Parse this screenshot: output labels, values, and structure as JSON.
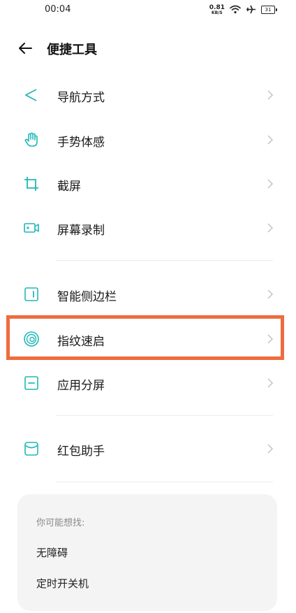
{
  "status_bar": {
    "time": "00:04",
    "net_speed_value": "0.81",
    "net_speed_unit": "KB/S",
    "battery": "31",
    "icons": [
      "wifi-icon",
      "airplane-icon",
      "battery-icon"
    ]
  },
  "header": {
    "title": "便捷工具"
  },
  "accent_color": "#20b7b7",
  "highlight_color": "#ef6c3e",
  "groups": [
    {
      "items": [
        {
          "label": "导航方式",
          "icon": "navigation-icon"
        },
        {
          "label": "手势体感",
          "icon": "hand-gesture-icon"
        },
        {
          "label": "截屏",
          "icon": "crop-icon"
        },
        {
          "label": "屏幕录制",
          "icon": "screen-record-icon"
        }
      ]
    },
    {
      "items": [
        {
          "label": "智能侧边栏",
          "icon": "sidebar-icon"
        },
        {
          "label": "指纹速启",
          "icon": "fingerprint-icon"
        },
        {
          "label": "应用分屏",
          "icon": "split-screen-icon"
        }
      ]
    },
    {
      "items": [
        {
          "label": "红包助手",
          "icon": "red-packet-icon"
        }
      ]
    }
  ],
  "suggestions": {
    "title": "你可能想找:",
    "items": [
      "无障碍",
      "定时开关机"
    ]
  }
}
